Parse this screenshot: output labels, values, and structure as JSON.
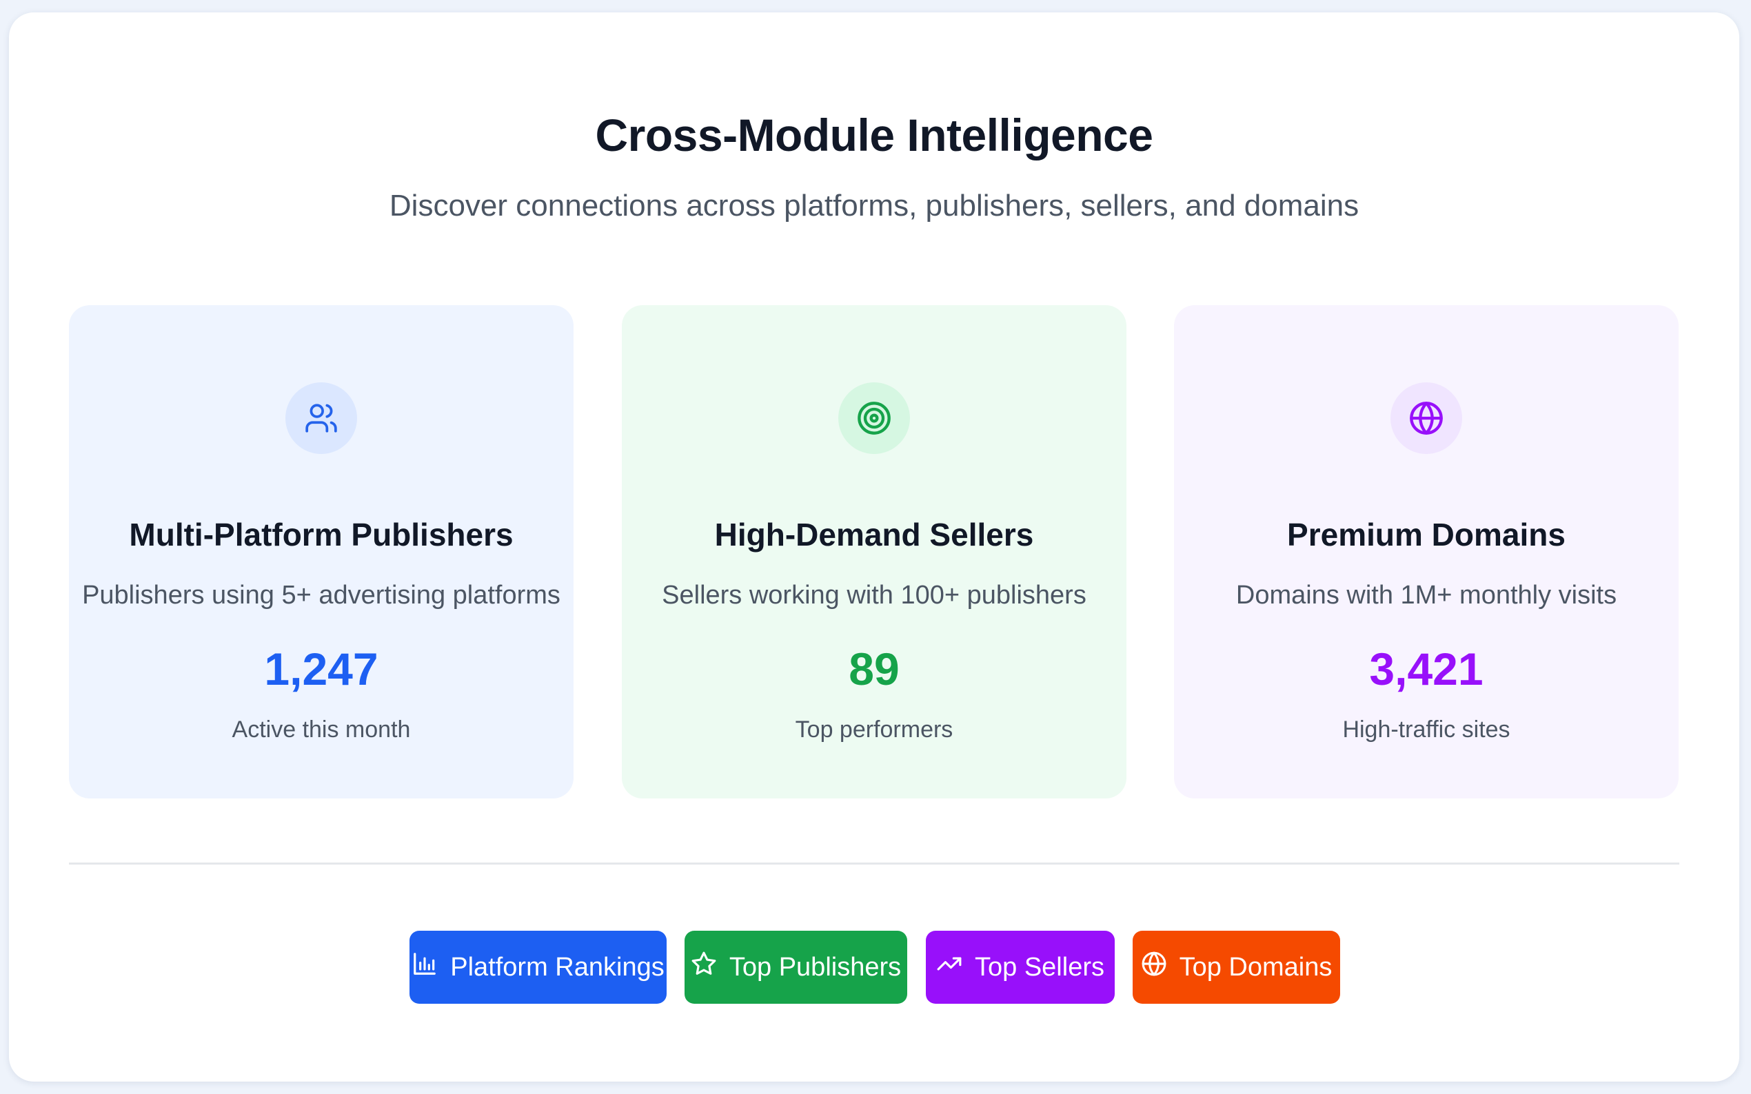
{
  "header": {
    "title": "Cross-Module Intelligence",
    "subtitle": "Discover connections across platforms, publishers, sellers, and domains"
  },
  "cards": [
    {
      "icon": "users-icon",
      "title": "Multi-Platform Publishers",
      "description": "Publishers using 5+ advertising platforms",
      "value": "1,247",
      "caption": "Active this month",
      "accent": "#1d5ff2"
    },
    {
      "icon": "target-icon",
      "title": "High-Demand Sellers",
      "description": "Sellers working with 100+ publishers",
      "value": "89",
      "caption": "Top performers",
      "accent": "#16a34a"
    },
    {
      "icon": "globe-icon",
      "title": "Premium Domains",
      "description": "Domains with 1M+ monthly visits",
      "value": "3,421",
      "caption": "High-traffic sites",
      "accent": "#9810fa"
    }
  ],
  "actions": [
    {
      "label": "Platform Rankings",
      "icon": "bar-chart-icon",
      "color": "#1d5ff2"
    },
    {
      "label": "Top Publishers",
      "icon": "star-icon",
      "color": "#16a34a"
    },
    {
      "label": "Top Sellers",
      "icon": "trending-up-icon",
      "color": "#9810fa"
    },
    {
      "label": "Top Domains",
      "icon": "globe-icon",
      "color": "#f54a00"
    }
  ]
}
